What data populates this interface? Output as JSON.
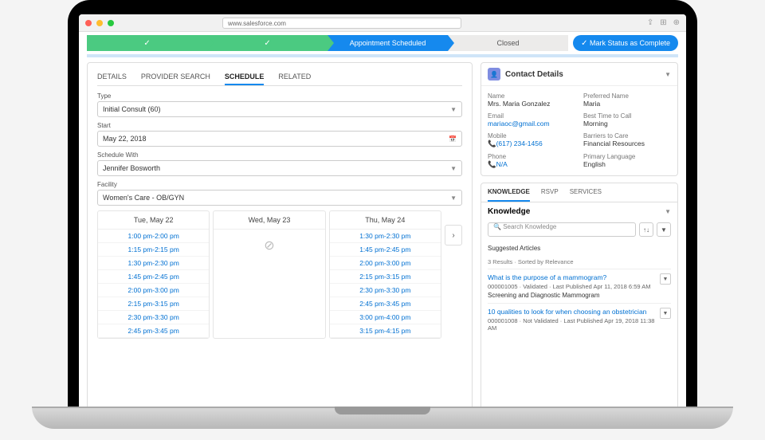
{
  "browser": {
    "url": "www.salesforce.com"
  },
  "path": {
    "steps": [
      "",
      "",
      "Appointment Scheduled",
      "Closed"
    ],
    "completeBtn": "Mark Status as Complete"
  },
  "tabs": [
    "DETAILS",
    "PROVIDER SEARCH",
    "SCHEDULE",
    "RELATED"
  ],
  "activeTab": 2,
  "form": {
    "type": {
      "label": "Type",
      "value": "Initial Consult (60)"
    },
    "start": {
      "label": "Start",
      "value": "May 22, 2018"
    },
    "with": {
      "label": "Schedule With",
      "value": "Jennifer Bosworth"
    },
    "facility": {
      "label": "Facility",
      "value": "Women's Care - OB/GYN"
    }
  },
  "schedule": {
    "cols": [
      {
        "day": "Tue, May 22",
        "slots": [
          "1:00 pm-2:00 pm",
          "1:15 pm-2:15 pm",
          "1:30 pm-2:30 pm",
          "1:45 pm-2:45 pm",
          "2:00 pm-3:00 pm",
          "2:15 pm-3:15 pm",
          "2:30 pm-3:30 pm",
          "2:45 pm-3:45 pm"
        ]
      },
      {
        "day": "Wed, May 23",
        "slots": []
      },
      {
        "day": "Thu, May 24",
        "slots": [
          "1:30 pm-2:30 pm",
          "1:45 pm-2:45 pm",
          "2:00 pm-3:00 pm",
          "2:15 pm-3:15 pm",
          "2:30 pm-3:30 pm",
          "2:45 pm-3:45 pm",
          "3:00 pm-4:00 pm",
          "3:15 pm-4:15 pm"
        ]
      }
    ]
  },
  "contact": {
    "title": "Contact Details",
    "name": {
      "l": "Name",
      "v": "Mrs. Maria Gonzalez"
    },
    "pref": {
      "l": "Preferred Name",
      "v": "Maria"
    },
    "email": {
      "l": "Email",
      "v": "mariaoc@gmail.com"
    },
    "best": {
      "l": "Best Time to Call",
      "v": "Morning"
    },
    "mobile": {
      "l": "Mobile",
      "v": "(617) 234-1456"
    },
    "barrier": {
      "l": "Barriers to Care",
      "v": "Financial Resources"
    },
    "phone": {
      "l": "Phone",
      "v": "N/A"
    },
    "lang": {
      "l": "Primary Language",
      "v": "English"
    }
  },
  "knowledge": {
    "tabs": [
      "KNOWLEDGE",
      "RSVP",
      "SERVICES"
    ],
    "header": "Knowledge",
    "searchPlaceholder": "Search Knowledge",
    "suggested": "Suggested Articles",
    "results": "3 Results · Sorted by Relevance",
    "items": [
      {
        "t": "What is the purpose of a mammogram?",
        "m": "000001005 · Validated · Last Published Apr 11, 2018 6:59 AM",
        "d": "Screening and Diagnostic Mammogram"
      },
      {
        "t": "10 qualities to look for when choosing an obstetrician",
        "m": "000001008 · Not Validated · Last Published Apr 19, 2018 11:38 AM",
        "d": ""
      }
    ]
  }
}
